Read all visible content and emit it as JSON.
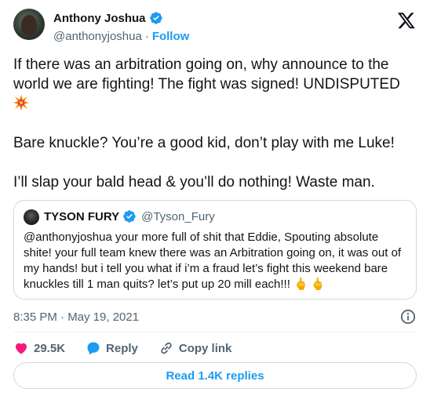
{
  "author": {
    "name": "Anthony Joshua",
    "handle": "@anthonyjoshua",
    "separator": "·",
    "follow_label": "Follow"
  },
  "tweet": {
    "paragraphs": [
      "If there was an arbitration going on, why announce to the world we are fighting! The fight was signed! UNDISPUTED",
      "Bare knuckle? You’re a good kid, don’t play with me Luke!",
      "I’ll slap your bald head & you’ll do nothing! Waste man."
    ],
    "emoji": "collision-emoji"
  },
  "quoted": {
    "name": "TYSON FURY",
    "handle": "@Tyson_Fury",
    "text": "@anthonyjoshua your more full of shit that Eddie, Spouting absolute shite! your full team knew there was an Arbitration going on, it was out of my hands! but i tell you what if i’m a fraud let’s fight this weekend bare knuckles till 1 man quits? let’s put up 20 mill each!!!",
    "emoji": "🖕🖕"
  },
  "timestamp": "8:35 PM · May 19, 2021",
  "actions": {
    "likes": "29.5K",
    "reply_label": "Reply",
    "copy_link_label": "Copy link"
  },
  "read_replies_label": "Read 1.4K replies",
  "colors": {
    "accent": "#1d9bf0",
    "like": "#f91880",
    "text": "#0f1419",
    "muted": "#536471"
  }
}
